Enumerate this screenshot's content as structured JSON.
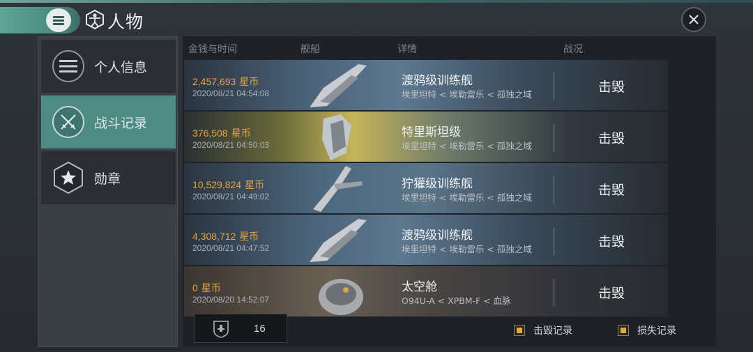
{
  "header": {
    "title": "人物"
  },
  "sidebar": {
    "items": [
      {
        "label": "个人信息",
        "icon": "list-icon"
      },
      {
        "label": "战斗记录",
        "icon": "crossed-swords-icon"
      },
      {
        "label": "勋章",
        "icon": "star-badge-icon"
      }
    ],
    "active_index": 1
  },
  "table": {
    "headers": {
      "money_time": "金钱与时间",
      "ship": "舰船",
      "detail": "详情",
      "status": "战况"
    },
    "rows": [
      {
        "amount": "2,457,693",
        "unit": "星币",
        "time": "2020/08/21  04:54:08",
        "ship": "渡鸦级训练舰",
        "location": "埃里坦特 < 埃勒雷乐 < 孤独之域",
        "result": "击毁"
      },
      {
        "amount": "376,508",
        "unit": "星币",
        "time": "2020/08/21  04:50:03",
        "ship": "特里斯坦级",
        "location": "埃里坦特 < 埃勒雷乐 < 孤独之域",
        "result": "击毁"
      },
      {
        "amount": "10,529,824",
        "unit": "星币",
        "time": "2020/08/21  04:49:02",
        "ship": "狞獾级训练舰",
        "location": "埃里坦特 < 埃勒雷乐 < 孤独之域",
        "result": "击毁"
      },
      {
        "amount": "4,308,712",
        "unit": "星币",
        "time": "2020/08/21  04:47:52",
        "ship": "渡鸦级训练舰",
        "location": "埃里坦特 < 埃勒雷乐 < 孤独之域",
        "result": "击毁"
      },
      {
        "amount": "0",
        "unit": "星币",
        "time": "2020/08/20  14:52:07",
        "ship": "太空舱",
        "location": "O94U-A < XPBM-F < 血脉",
        "result": "击毁"
      }
    ]
  },
  "footer": {
    "count": "16",
    "kill_label": "击毁记录",
    "loss_label": "损失记录"
  },
  "colors": {
    "accent": "#4f8b85",
    "money": "#e5a53a",
    "checkbox": "#e6a93a"
  }
}
